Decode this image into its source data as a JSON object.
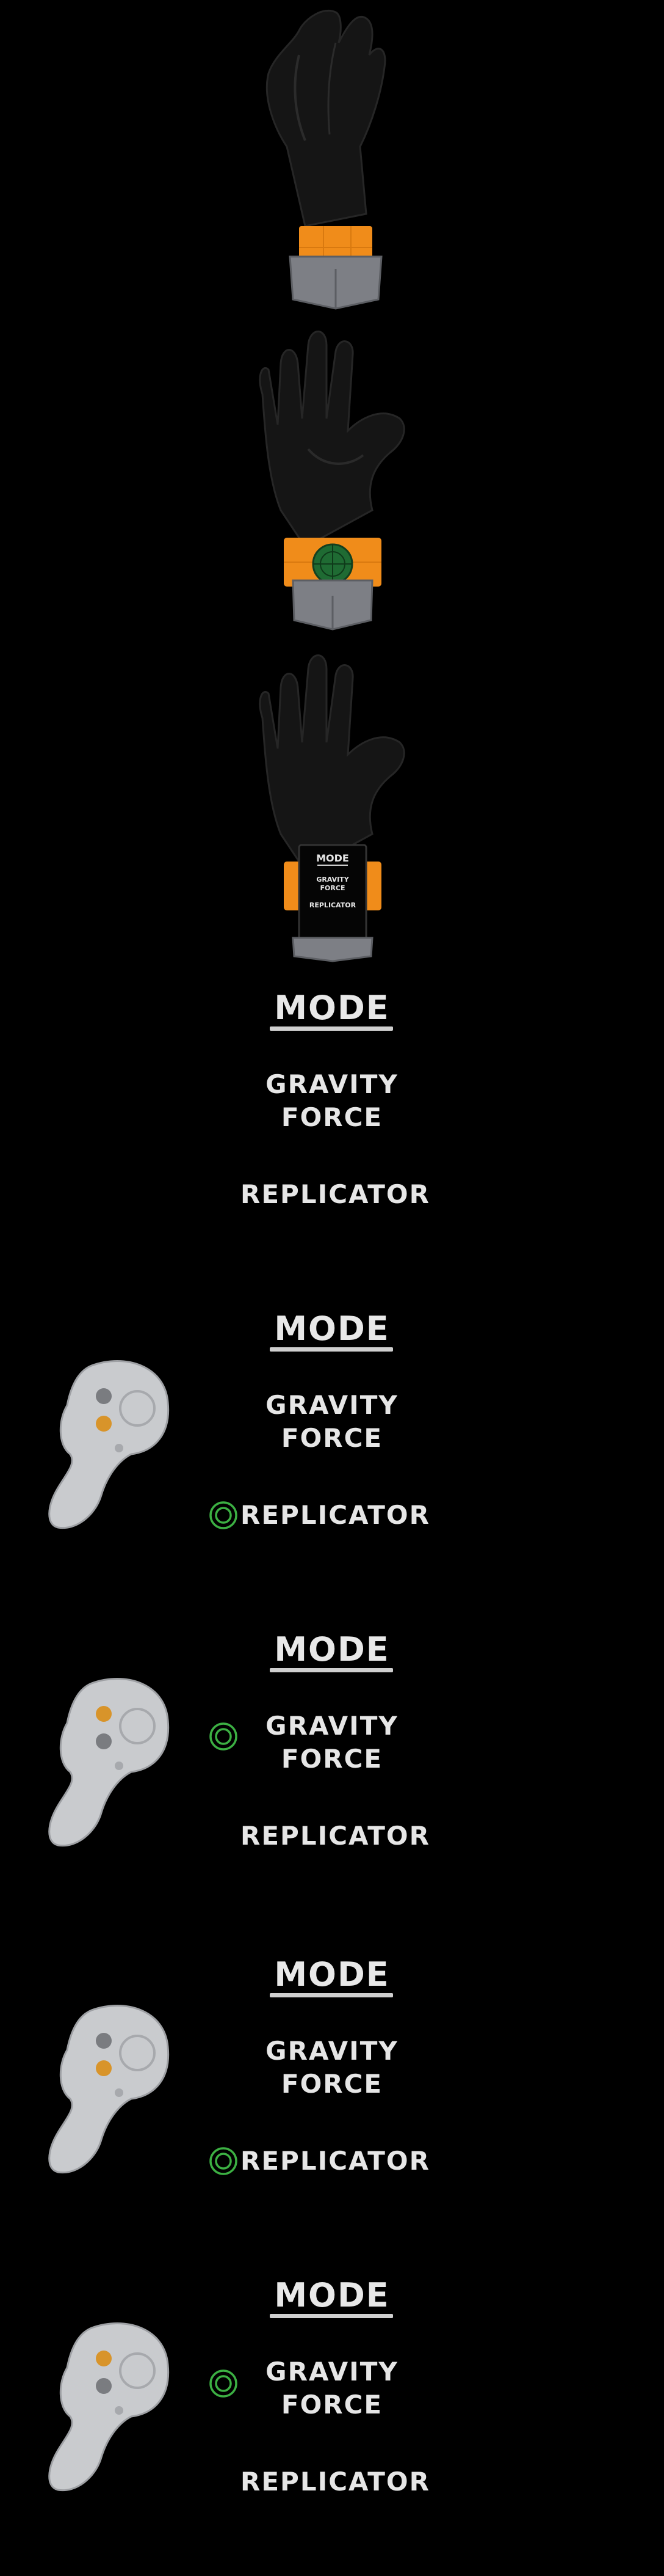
{
  "panel": {
    "mode_title": "MODE",
    "options": {
      "gravity_line1": "GRAVITY",
      "gravity_line2": "FORCE",
      "replicator": "REPLICATOR"
    }
  },
  "wrist_display": {
    "mode_title": "MODE",
    "gravity_line1": "GRAVITY",
    "gravity_line2": "FORCE",
    "replicator": "REPLICATOR"
  },
  "selection_sequence": [
    {
      "frame": 1,
      "selected": "none",
      "highlighted_button": "none"
    },
    {
      "frame": 2,
      "selected": "replicator",
      "highlighted_button": "lower"
    },
    {
      "frame": 3,
      "selected": "gravity-force",
      "highlighted_button": "upper"
    },
    {
      "frame": 4,
      "selected": "replicator",
      "highlighted_button": "lower"
    },
    {
      "frame": 5,
      "selected": "gravity-force",
      "highlighted_button": "upper"
    }
  ],
  "colors": {
    "background": "#000000",
    "text": "#e6e6e6",
    "glove": "#141414",
    "wrist_band": "#f08c1a",
    "wrist_base": "#7d7f85",
    "radar_green": "#1f6b33",
    "target_ring": "#3cb043",
    "controller_body": "#c9cbce",
    "button_highlight": "#d8942a",
    "button_idle": "#7a7c80"
  },
  "icons": [
    "glove-icon",
    "wrist-device-icon",
    "radar-icon",
    "target-ring-icon",
    "vr-controller-icon"
  ]
}
